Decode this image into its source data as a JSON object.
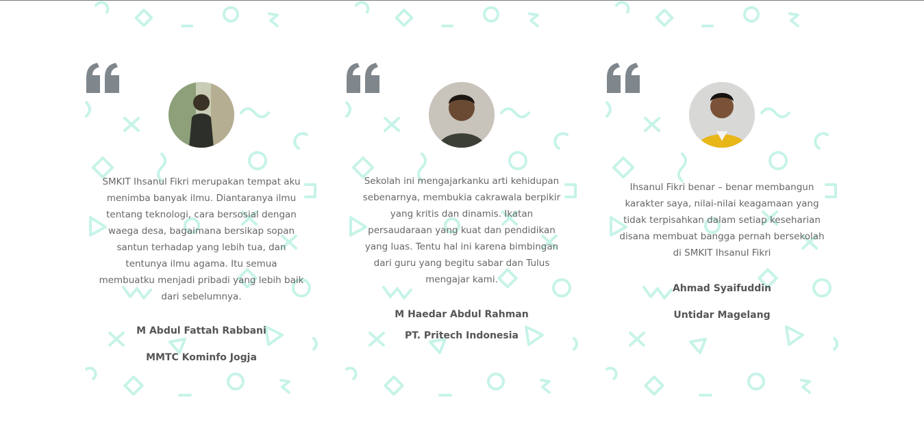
{
  "section": {
    "accent_color": "#c6f3e8",
    "quote_icon_color": "#7f868c"
  },
  "testimonials": [
    {
      "avatar_icon": "person-photo",
      "quote": "SMKIT Ihsanul Fikri merupakan tempat aku menimba banyak ilmu. Diantaranya ilmu tentang teknologi, cara bersosial dengan waega desa, bagaimana bersikap sopan santun terhadap yang lebih tua, dan tentunya ilmu agama. Itu semua membuatku menjadi pribadi yang lebih baik dari sebelumnya.",
      "name": "M Abdul Fattah Rabbani",
      "organization": "MMTC Kominfo Jogja"
    },
    {
      "avatar_icon": "person-photo",
      "quote": "Sekolah ini mengajarkanku arti kehidupan sebenarnya, membukia cakrawala berpikir yang kritis dan dinamis. Ikatan persaudaraan yang kuat dan pendidikan yang luas. Tentu hal ini karena bimbingan dari guru yang begitu sabar dan Tulus mengajar kami.",
      "name": "M Haedar Abdul Rahman",
      "organization": "PT. Pritech Indonesia"
    },
    {
      "avatar_icon": "person-photo",
      "quote": "Ihsanul Fikri benar – benar membangun karakter saya, nilai-nilai keagamaan yang tidak terpisahkan dalam setiap keseharian disana membuat bangga pernah bersekolah di SMKIT Ihsanul Fikri",
      "name": "Ahmad Syaifuddin",
      "organization": "Untidar Magelang"
    }
  ]
}
